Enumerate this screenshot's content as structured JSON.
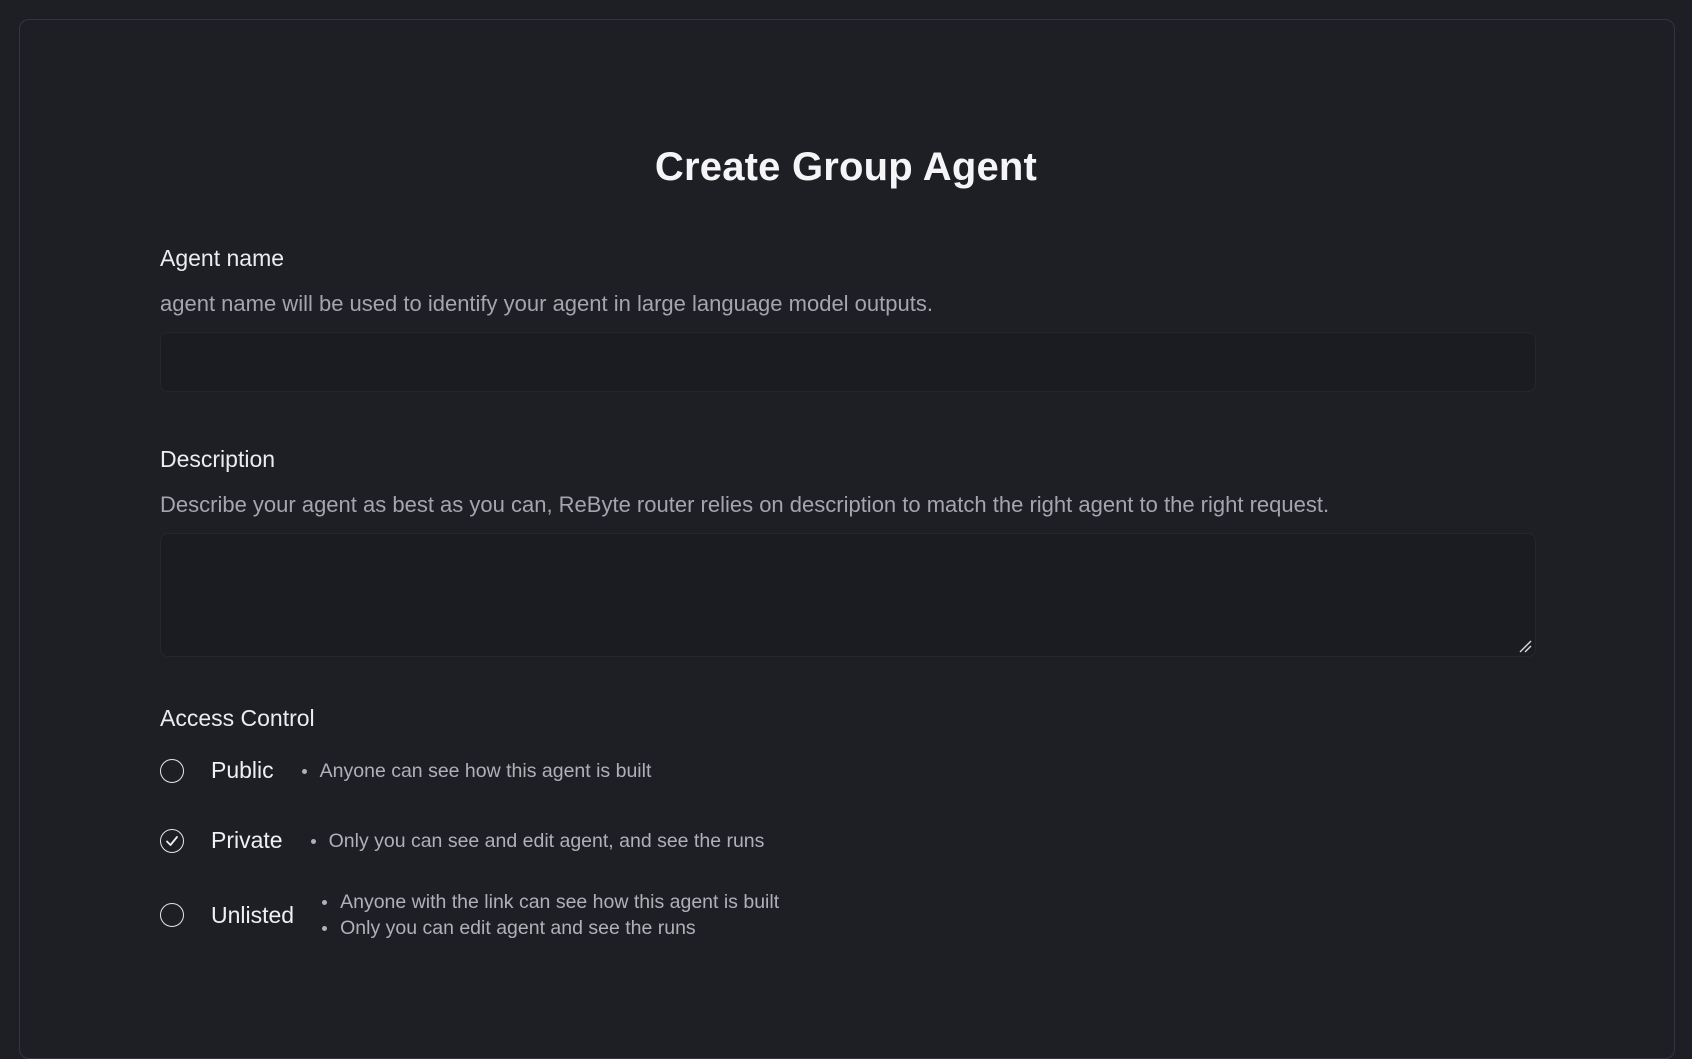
{
  "page": {
    "title": "Create Group Agent"
  },
  "agent_name": {
    "label": "Agent name",
    "help": "agent name will be used to identify your agent in large language model outputs.",
    "value": "",
    "placeholder": ""
  },
  "description": {
    "label": "Description",
    "help": "Describe your agent as best as you can, ReByte router relies on description to match the right agent to the right request.",
    "value": ""
  },
  "access_control": {
    "label": "Access Control",
    "options": [
      {
        "label": "Public",
        "selected": false,
        "notes": [
          "Anyone can see how this agent is built"
        ]
      },
      {
        "label": "Private",
        "selected": true,
        "notes": [
          "Only you can see and edit agent, and see the runs"
        ]
      },
      {
        "label": "Unlisted",
        "selected": false,
        "notes": [
          "Anyone with the link can see how this agent is built",
          "Only you can edit agent and see the runs"
        ]
      }
    ]
  },
  "colors": {
    "background": "#1e1f25",
    "input_background": "#1b1c21",
    "text_primary": "#f0f0f3",
    "text_secondary": "#a4a5ad"
  }
}
